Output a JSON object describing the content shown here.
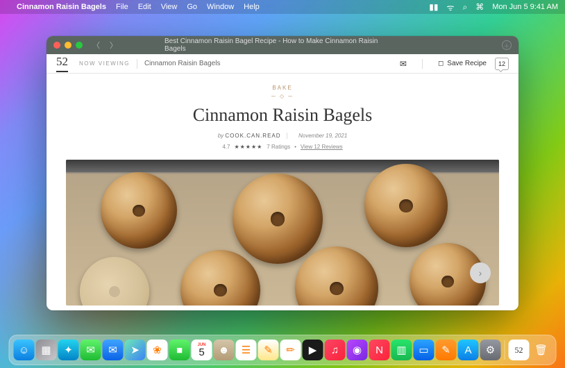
{
  "menubar": {
    "app_name": "Cinnamon Raisin Bagels",
    "menus": [
      "File",
      "Edit",
      "View",
      "Go",
      "Window",
      "Help"
    ],
    "datetime": "Mon Jun 5 9:41 AM"
  },
  "window": {
    "title": "Best Cinnamon Raisin Bagel Recipe - How to Make Cinnamon Raisin Bagels"
  },
  "header": {
    "logo": "52",
    "now_viewing_label": "NOW VIEWING",
    "viewing_title": "Cinnamon Raisin Bagels",
    "save_label": "Save Recipe",
    "comment_count": "12"
  },
  "recipe": {
    "category": "BAKE",
    "title": "Cinnamon Raisin Bagels",
    "by_label": "by",
    "author": "COOK.CAN.READ",
    "date": "November 19, 2021",
    "rating_value": "4.7",
    "stars": "★★★★★",
    "ratings_text": "7 Ratings",
    "reviews_link": "View 12 Reviews"
  },
  "dock": {
    "items": [
      {
        "name": "finder",
        "bg": "linear-gradient(180deg,#3ac3ff,#0a7fe0)",
        "glyph": "☺"
      },
      {
        "name": "launchpad",
        "bg": "linear-gradient(135deg,#8e8e93,#c7c7cc)",
        "glyph": "▦"
      },
      {
        "name": "safari",
        "bg": "linear-gradient(180deg,#22d3ee,#0284c7)",
        "glyph": "✦"
      },
      {
        "name": "messages",
        "bg": "linear-gradient(180deg,#5ff36b,#1ebb32)",
        "glyph": "✉"
      },
      {
        "name": "mail",
        "bg": "linear-gradient(180deg,#3fa3ff,#0a63e6)",
        "glyph": "✉"
      },
      {
        "name": "maps",
        "bg": "linear-gradient(135deg,#6ee7b7,#3b82f6)",
        "glyph": "➤"
      },
      {
        "name": "photos",
        "bg": "#fff",
        "glyph": "❀"
      },
      {
        "name": "facetime",
        "bg": "linear-gradient(180deg,#5ff36b,#1ebb32)",
        "glyph": "■"
      },
      {
        "name": "calendar",
        "bg": "#fff",
        "glyph": "5"
      },
      {
        "name": "contacts",
        "bg": "linear-gradient(180deg,#d4c5a9,#b39c76)",
        "glyph": "☻"
      },
      {
        "name": "reminders",
        "bg": "#fff",
        "glyph": "☰"
      },
      {
        "name": "notes",
        "bg": "linear-gradient(180deg,#fff,#ffe789)",
        "glyph": "✎"
      },
      {
        "name": "freeform",
        "bg": "#fff",
        "glyph": "✏"
      },
      {
        "name": "tv",
        "bg": "#1a1a1a",
        "glyph": "▶"
      },
      {
        "name": "music",
        "bg": "linear-gradient(135deg,#fb4665,#fa233b)",
        "glyph": "♫"
      },
      {
        "name": "podcasts",
        "bg": "linear-gradient(135deg,#b847ff,#7a28e0)",
        "glyph": "◉"
      },
      {
        "name": "news",
        "bg": "linear-gradient(135deg,#ff4860,#fa233b)",
        "glyph": "N"
      },
      {
        "name": "numbers",
        "bg": "linear-gradient(180deg,#27e36b,#18b850)",
        "glyph": "▥"
      },
      {
        "name": "keynote",
        "bg": "linear-gradient(180deg,#2ca3ff,#0561e6)",
        "glyph": "▭"
      },
      {
        "name": "pages",
        "bg": "linear-gradient(180deg,#ff9a2e,#ff7a00)",
        "glyph": "✎"
      },
      {
        "name": "appstore",
        "bg": "linear-gradient(180deg,#20c5ff,#0b7fe6)",
        "glyph": "A"
      },
      {
        "name": "settings",
        "bg": "linear-gradient(180deg,#9598a1,#686a71)",
        "glyph": "⚙"
      }
    ],
    "right": [
      {
        "name": "food52",
        "bg": "#fff",
        "glyph": "52"
      },
      {
        "name": "trash",
        "bg": "transparent",
        "glyph": "🗑"
      }
    ],
    "cal_top": "JUN"
  }
}
